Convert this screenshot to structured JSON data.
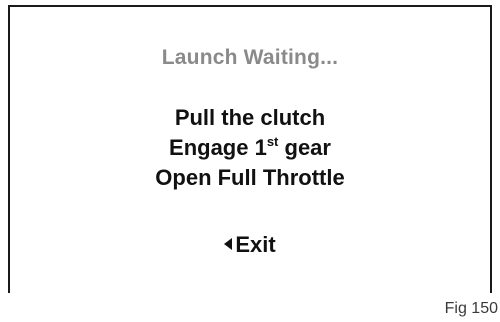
{
  "screen": {
    "status_text": "Launch Waiting...",
    "instructions": {
      "line1": "Pull the clutch",
      "line2_prefix": "Engage 1",
      "line2_sup": "st",
      "line2_suffix": " gear",
      "line3": "Open Full Throttle"
    },
    "exit_label": "Exit",
    "exit_icon": "left-triangle-icon"
  },
  "caption": "Fig 150"
}
